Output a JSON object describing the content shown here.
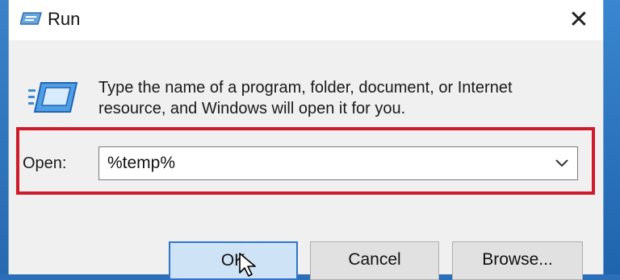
{
  "window": {
    "title": "Run",
    "close_glyph": "✕"
  },
  "description": {
    "line1": "Type the name of a program, folder, document, or Internet",
    "line2": "resource, and Windows will open it for you."
  },
  "open_field": {
    "label": "Open:",
    "value": "%temp%"
  },
  "buttons": {
    "ok": "OK",
    "cancel": "Cancel",
    "browse": "Browse..."
  },
  "icons": {
    "title": "run-app-icon",
    "main": "run-program-icon",
    "dropdown": "chevron-down-icon",
    "cursor": "mouse-pointer-icon"
  },
  "colors": {
    "highlight_frame": "#cf1a2b",
    "default_button_border": "#2f74c9",
    "dialog_background": "#f0f0f0"
  }
}
